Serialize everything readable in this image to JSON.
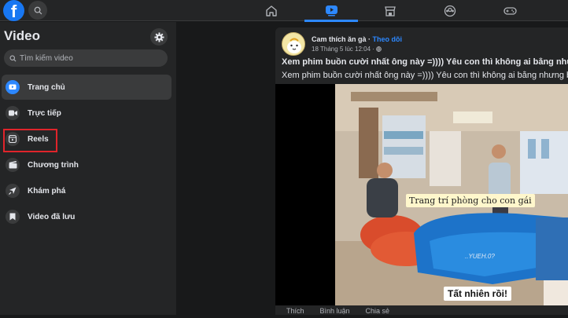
{
  "topbar": {
    "logo_letter": "f",
    "icons": [
      "search-icon",
      "home-icon",
      "video-icon",
      "marketplace-icon",
      "groups-icon",
      "gaming-icon"
    ]
  },
  "sidebar": {
    "title": "Video",
    "search_placeholder": "Tìm kiếm video",
    "items": [
      {
        "label": "Trang chủ",
        "icon": "video-home-icon"
      },
      {
        "label": "Trực tiếp",
        "icon": "live-icon"
      },
      {
        "label": "Reels",
        "icon": "reels-icon"
      },
      {
        "label": "Chương trình",
        "icon": "shows-icon"
      },
      {
        "label": "Khám phá",
        "icon": "explore-icon"
      },
      {
        "label": "Video đã lưu",
        "icon": "saved-icon"
      }
    ]
  },
  "post": {
    "author": "Cam thích ăn gà",
    "separator": " · ",
    "follow": "Theo dõi",
    "timestamp": "18 Tháng 5 lúc 12:04 · ",
    "caption_bold": "Xem phim buồn cười nhất ông này =)))) Yêu con thì không ai bằng nhưng",
    "caption": "Xem phim buồn cười nhất ông này =)))) Yêu con thì không ai bằng nhưng bi",
    "video": {
      "subtitle": "Trang trí phòng cho con gái",
      "bottom_text": "Tất nhiên rồi!",
      "watermark": "..YUEH.0?"
    },
    "actions": [
      "Thích",
      "Bình luận",
      "Chia sẻ"
    ]
  },
  "colors": {
    "accent": "#2d88ff",
    "highlight_box": "#e0242b",
    "brand": "#1877f2"
  }
}
